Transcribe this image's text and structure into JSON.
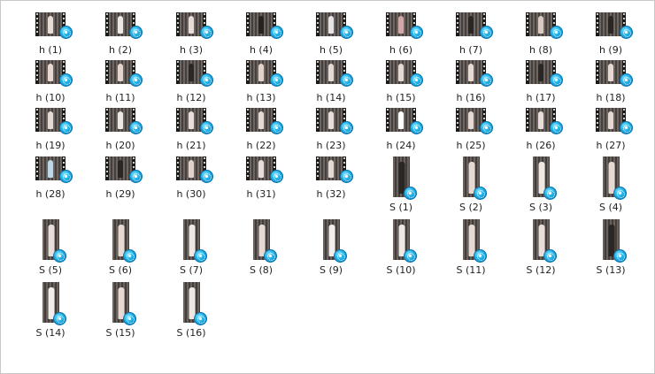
{
  "files": [
    {
      "name": "h (1)",
      "type": "video",
      "figure": "#e9dcd4"
    },
    {
      "name": "h (2)",
      "type": "video",
      "figure": "#efe7e2"
    },
    {
      "name": "h (3)",
      "type": "video",
      "figure": "#e6dbd5"
    },
    {
      "name": "h (4)",
      "type": "video",
      "figure": "#262220"
    },
    {
      "name": "h (5)",
      "type": "video",
      "figure": "#e7e4e6"
    },
    {
      "name": "h (6)",
      "type": "video",
      "figure": "#d3a7a8"
    },
    {
      "name": "h (7)",
      "type": "video",
      "figure": "#2a2624"
    },
    {
      "name": "h (8)",
      "type": "video",
      "figure": "#d9c9c3"
    },
    {
      "name": "h (9)",
      "type": "video",
      "figure": "#2a2624"
    },
    {
      "name": "h (10)",
      "type": "video",
      "figure": "#e8d8d0"
    },
    {
      "name": "h (11)",
      "type": "video",
      "figure": "#e4d4ce"
    },
    {
      "name": "h (12)",
      "type": "video",
      "figure": "#2b2725"
    },
    {
      "name": "h (13)",
      "type": "video",
      "figure": "#e1d2cc"
    },
    {
      "name": "h (14)",
      "type": "video",
      "figure": "#e6d8d2"
    },
    {
      "name": "h (15)",
      "type": "video",
      "figure": "#e6d9d3"
    },
    {
      "name": "h (16)",
      "type": "video",
      "figure": "#e8dbd5"
    },
    {
      "name": "h (17)",
      "type": "video",
      "figure": "#2a2624"
    },
    {
      "name": "h (18)",
      "type": "video",
      "figure": "#e6d8d2"
    },
    {
      "name": "h (19)",
      "type": "video",
      "figure": "#e6d8d2"
    },
    {
      "name": "h (20)",
      "type": "video",
      "figure": "#efe7e2"
    },
    {
      "name": "h (21)",
      "type": "video",
      "figure": "#e8ddd8"
    },
    {
      "name": "h (22)",
      "type": "video",
      "figure": "#e6d9d3"
    },
    {
      "name": "h (23)",
      "type": "video",
      "figure": "#e8ddd8"
    },
    {
      "name": "h (24)",
      "type": "video",
      "figure": "#ffffff"
    },
    {
      "name": "h (25)",
      "type": "video",
      "figure": "#e6d8d2"
    },
    {
      "name": "h (26)",
      "type": "video",
      "figure": "#e8ddd8"
    },
    {
      "name": "h (27)",
      "type": "video",
      "figure": "#e6d8d2"
    },
    {
      "name": "h (28)",
      "type": "video",
      "figure": "#bcd6ea"
    },
    {
      "name": "h (29)",
      "type": "video",
      "figure": "#2a2624"
    },
    {
      "name": "h (30)",
      "type": "video",
      "figure": "#e1d2cc"
    },
    {
      "name": "h (31)",
      "type": "video",
      "figure": "#e8ddd8"
    },
    {
      "name": "h (32)",
      "type": "video",
      "figure": "#e6d9d3"
    },
    {
      "name": "S (1)",
      "type": "portrait",
      "figure": "#2a2624"
    },
    {
      "name": "S (2)",
      "type": "portrait",
      "figure": "#e6d8d2"
    },
    {
      "name": "S (3)",
      "type": "portrait",
      "figure": "#efe7e2"
    },
    {
      "name": "S (4)",
      "type": "portrait",
      "figure": "#e6d8d2"
    },
    {
      "name": "S (5)",
      "type": "portrait",
      "figure": "#e8ddd8"
    },
    {
      "name": "S (6)",
      "type": "portrait",
      "figure": "#e6d8d2"
    },
    {
      "name": "S (7)",
      "type": "portrait",
      "figure": "#efe7e2"
    },
    {
      "name": "S (8)",
      "type": "portrait",
      "figure": "#e6d8d2"
    },
    {
      "name": "S (9)",
      "type": "portrait",
      "figure": "#f2ecea"
    },
    {
      "name": "S (10)",
      "type": "portrait",
      "figure": "#efe7e2"
    },
    {
      "name": "S (11)",
      "type": "portrait",
      "figure": "#e6d8d2"
    },
    {
      "name": "S (12)",
      "type": "portrait",
      "figure": "#e8ddd8"
    },
    {
      "name": "S (13)",
      "type": "portrait",
      "figure": "#2a2624"
    },
    {
      "name": "S (14)",
      "type": "portrait",
      "figure": "#f2ecea"
    },
    {
      "name": "S (15)",
      "type": "portrait",
      "figure": "#e6d8d2"
    },
    {
      "name": "S (16)",
      "type": "portrait",
      "figure": "#efe7e2"
    }
  ]
}
